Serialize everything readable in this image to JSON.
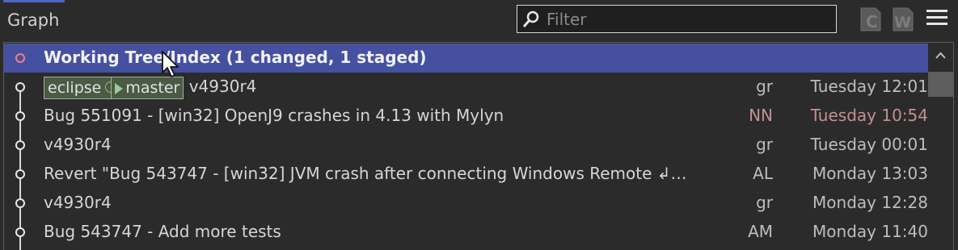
{
  "panel": {
    "title": "Graph"
  },
  "filter": {
    "placeholder": "Filter",
    "value": ""
  },
  "toolbar": {
    "icons": [
      "compare-icon",
      "workspace-icon",
      "menu-icon"
    ]
  },
  "working_tree": {
    "label": "Working Tree/Index (1 changed, 1 staged)"
  },
  "refs": {
    "branch1": "eclipse",
    "branch2": "master"
  },
  "commits": [
    {
      "message": "v4930r4",
      "author": "gr",
      "date": "Tuesday 12:01"
    },
    {
      "message": "Bug 551091 - [win32] OpenJ9 crashes in 4.13 with Mylyn",
      "author": "NN",
      "date": "Tuesday 10:54"
    },
    {
      "message": "v4930r4",
      "author": "gr",
      "date": "Tuesday 00:01"
    },
    {
      "message": "Revert \"Bug 543747 - [win32] JVM crash after connecting Windows Remote ↲…",
      "author": "AL",
      "date": "Monday 13:03"
    },
    {
      "message": "v4930r4",
      "author": "gr",
      "date": "Monday 12:28"
    },
    {
      "message": "Bug 543747 - Add more tests",
      "author": "AM",
      "date": "Monday 11:40"
    }
  ],
  "colors": {
    "selection": "#4550a1",
    "accent": "#4e66c8",
    "highlight_text": "#c49090"
  }
}
